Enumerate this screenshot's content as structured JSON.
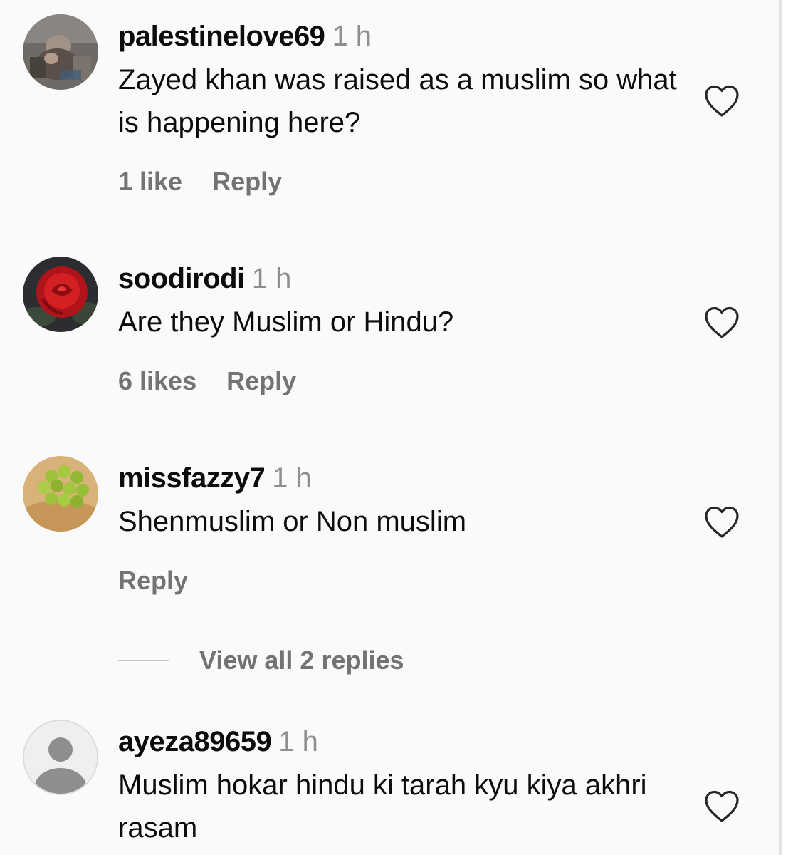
{
  "comments": [
    {
      "username": "palestinelove69",
      "time": "1 h",
      "text": "Zayed khan was raised as a muslim so what is happening here?",
      "likes": "1 like",
      "reply": "Reply"
    },
    {
      "username": "soodirodi",
      "time": "1 h",
      "text": "Are they Muslim or Hindu?",
      "likes": "6 likes",
      "reply": "Reply"
    },
    {
      "username": "missfazzy7",
      "time": "1 h",
      "text": "Shenmuslim or Non muslim",
      "reply": "Reply",
      "view_replies": "View all 2 replies"
    },
    {
      "username": "ayeza89659",
      "time": "1 h",
      "text": "Muslim hokar hindu ki tarah kyu kiya akhri rasam"
    }
  ],
  "colors": {
    "panel_bg": "#fafafa",
    "secondary_text": "#737373",
    "timestamp": "#8e8e8e"
  },
  "icons": {
    "like": "heart-outline-icon",
    "default_avatar": "person-silhouette-icon"
  }
}
